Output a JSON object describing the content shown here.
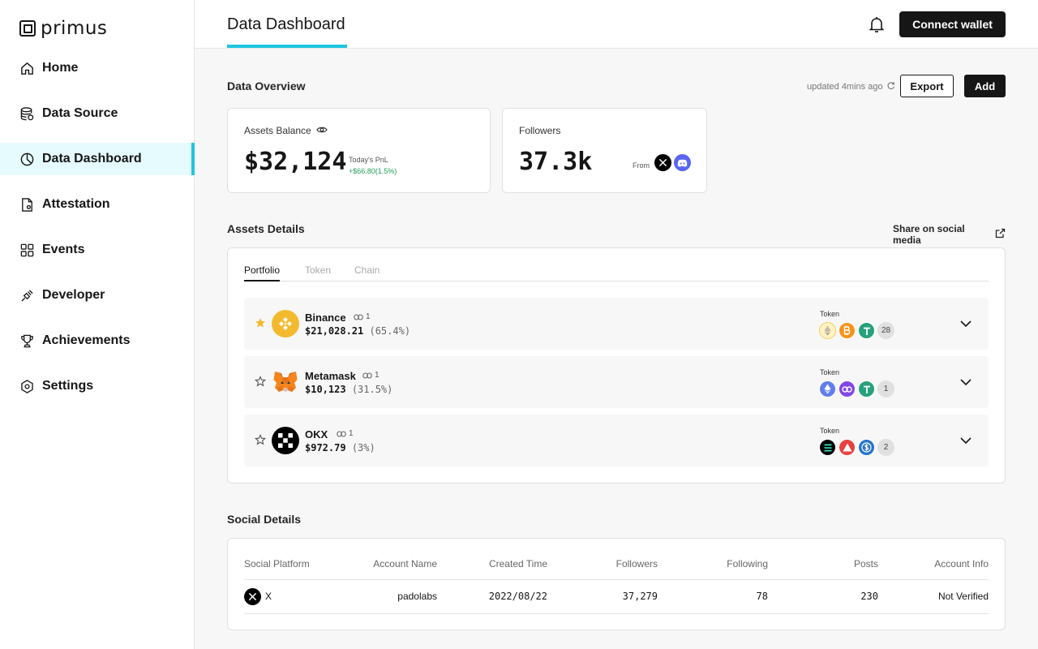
{
  "app": {
    "logo_text": "primus"
  },
  "sidebar": {
    "items": [
      {
        "label": "Home",
        "icon": "home-icon"
      },
      {
        "label": "Data Source",
        "icon": "database-icon"
      },
      {
        "label": "Data Dashboard",
        "icon": "pie-chart-icon",
        "active": true
      },
      {
        "label": "Attestation",
        "icon": "document-icon"
      },
      {
        "label": "Events",
        "icon": "grid-icon"
      },
      {
        "label": "Developer",
        "icon": "plug-icon"
      },
      {
        "label": "Achievements",
        "icon": "trophy-icon"
      },
      {
        "label": "Settings",
        "icon": "gear-icon"
      }
    ]
  },
  "header": {
    "title": "Data Dashboard",
    "connect_label": "Connect wallet"
  },
  "overview": {
    "title": "Data Overview",
    "updated": "updated 4mins ago",
    "export_label": "Export",
    "add_label": "Add",
    "assets": {
      "label": "Assets Balance",
      "value": "$32,124",
      "pnl_label": "Today's PnL",
      "pnl_value": "+$66.80(1.5%)"
    },
    "followers": {
      "label": "Followers",
      "value": "37.3k",
      "from_label": "From"
    }
  },
  "assets_details": {
    "title": "Assets Details",
    "share_label": "Share on social media",
    "tabs": [
      "Portfolio",
      "Token",
      "Chain"
    ],
    "token_label": "Token",
    "rows": [
      {
        "name": "Binance",
        "links": "1",
        "value": "$21,028.21",
        "pct": "(65.4%)",
        "starred": true,
        "extra": "28"
      },
      {
        "name": "Metamask",
        "links": "1",
        "value": "$10,123",
        "pct": "(31.5%)",
        "starred": false,
        "extra": "1"
      },
      {
        "name": "OKX",
        "links": "1",
        "value": "$972.79",
        "pct": "(3%)",
        "starred": false,
        "extra": "2"
      }
    ]
  },
  "social_details": {
    "title": "Social Details",
    "columns": [
      "Social Platform",
      "Account Name",
      "Created Time",
      "Followers",
      "Following",
      "Posts",
      "Account Info"
    ],
    "rows": [
      {
        "platform": "X",
        "account": "padolabs",
        "created": "2022/08/22",
        "followers": "37,279",
        "following": "78",
        "posts": "230",
        "info": "Not Verified"
      }
    ]
  },
  "colors": {
    "accent": "#1fc6df",
    "positive": "#21a05a",
    "dark": "#161616"
  }
}
